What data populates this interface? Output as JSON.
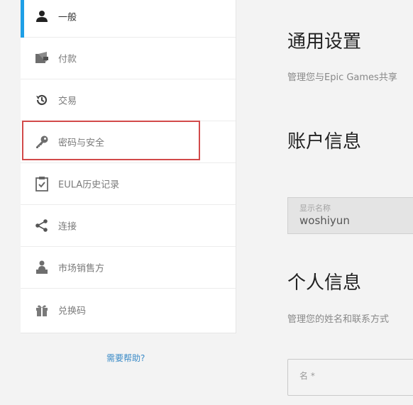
{
  "sidebar": {
    "items": [
      {
        "label": "一般",
        "icon": "user-icon",
        "active": true
      },
      {
        "label": "付款",
        "icon": "wallet-icon"
      },
      {
        "label": "交易",
        "icon": "history-icon"
      },
      {
        "label": "密码与安全",
        "icon": "key-icon",
        "highlighted": true
      },
      {
        "label": "EULA历史记录",
        "icon": "clipboard-check-icon"
      },
      {
        "label": "连接",
        "icon": "share-icon"
      },
      {
        "label": "市场销售方",
        "icon": "seller-icon"
      },
      {
        "label": "兑换码",
        "icon": "gift-icon"
      }
    ],
    "help_link": "需要帮助?"
  },
  "main": {
    "general_title": "通用设置",
    "general_desc": "管理您与Epic Games共享",
    "account_title": "账户信息",
    "display_name": {
      "label": "显示名称",
      "value": "woshiyun"
    },
    "personal_title": "个人信息",
    "personal_desc": "管理您的姓名和联系方式",
    "first_name_placeholder": "名 *"
  },
  "colors": {
    "accent": "#1f9fe6",
    "highlight": "#d24a4a",
    "link": "#3b8bc7"
  }
}
